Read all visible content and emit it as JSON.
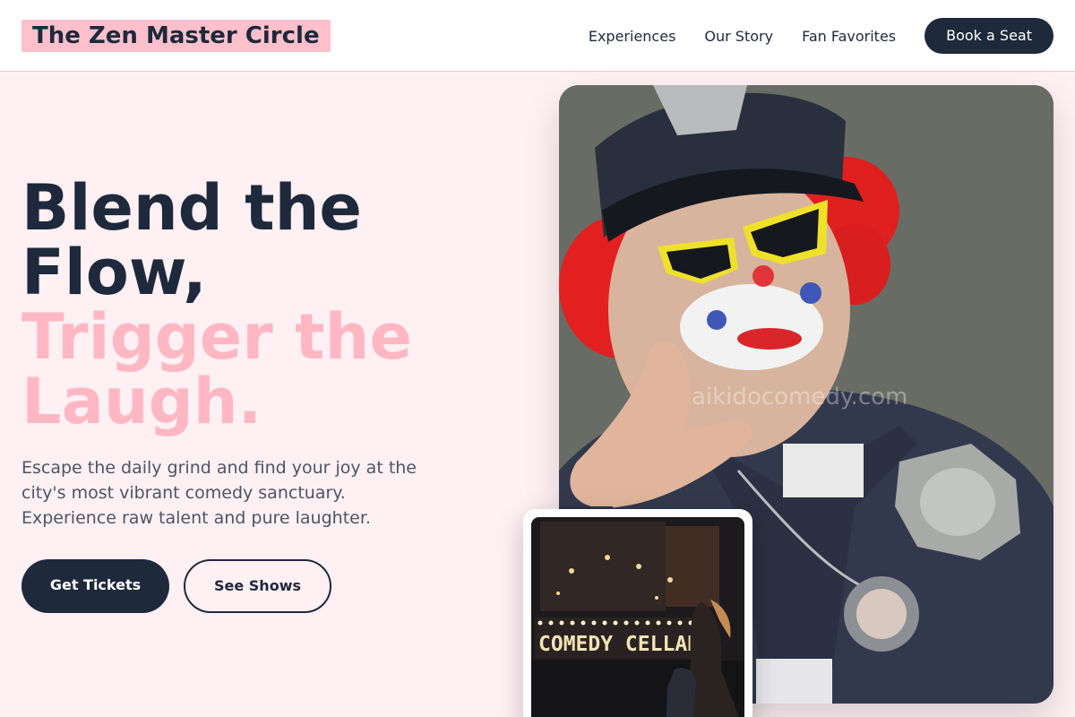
{
  "header": {
    "brand": "The Zen Master Circle",
    "nav": [
      "Experiences",
      "Our Story",
      "Fan Favorites"
    ],
    "cta": "Book a Seat"
  },
  "hero": {
    "title_line1": "Blend the",
    "title_line2": "Flow,",
    "title_line3": "Trigger the",
    "title_line4": "Laugh.",
    "subtitle": "Escape the daily grind and find your joy at the city's most vibrant comedy sanctuary. Experience raw talent and pure laughter.",
    "primary_button": "Get Tickets",
    "secondary_button": "See Shows"
  },
  "photos": {
    "main_watermark": "aikidocomedy.com",
    "inset_sign": "COMEDY CELLAR"
  },
  "colors": {
    "brand_dark": "#1e293b",
    "accent_pink": "#ffb7c4",
    "page_background": "#fff0f4"
  }
}
